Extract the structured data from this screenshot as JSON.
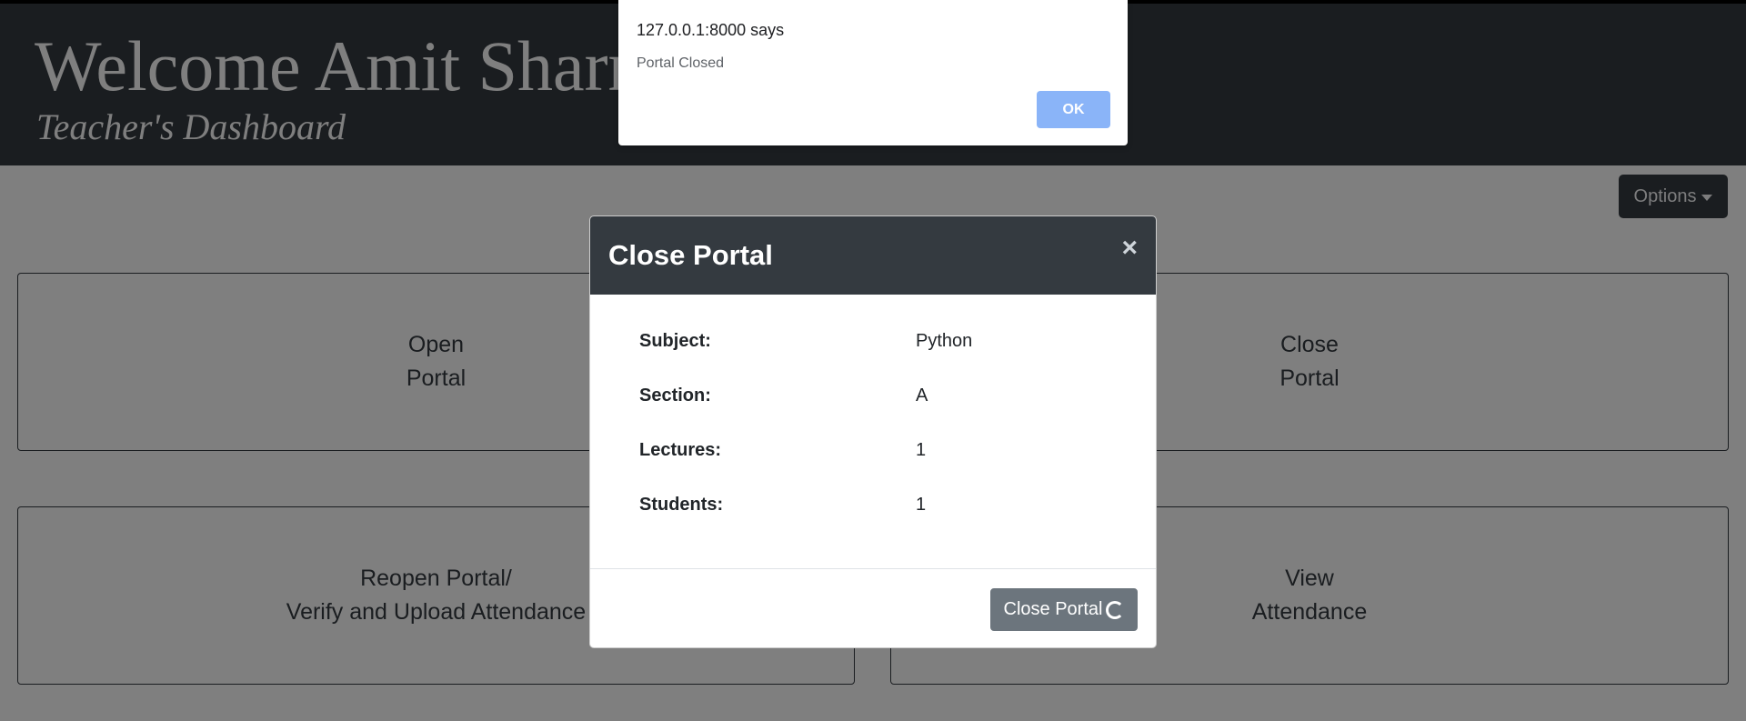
{
  "header": {
    "welcome": "Welcome Amit Sharma",
    "subtitle": "Teacher's Dashboard"
  },
  "options_button": {
    "label": "Options",
    "icon": "caret-down-icon"
  },
  "cards": {
    "open": "Open\nPortal",
    "close": "Close\nPortal",
    "reopen": "Reopen Portal/\nVerify and Upload Attendance",
    "view": "View\nAttendance"
  },
  "modal": {
    "title": "Close Portal",
    "close_glyph": "×",
    "rows": [
      {
        "key": "Subject:",
        "value": "Python"
      },
      {
        "key": "Section:",
        "value": "A"
      },
      {
        "key": "Lectures:",
        "value": "1"
      },
      {
        "key": "Students:",
        "value": "1"
      }
    ],
    "action_label": "Close Portal",
    "action_icon": "spinner-icon"
  },
  "alert": {
    "origin": "127.0.0.1:8000 says",
    "message": "Portal Closed",
    "ok_label": "OK"
  },
  "colors": {
    "header_bg": "#343a40",
    "backdrop": "rgba(0,0,0,0.5)",
    "secondary_button": "#6c757d",
    "alert_ok": "#8ab4f8"
  }
}
